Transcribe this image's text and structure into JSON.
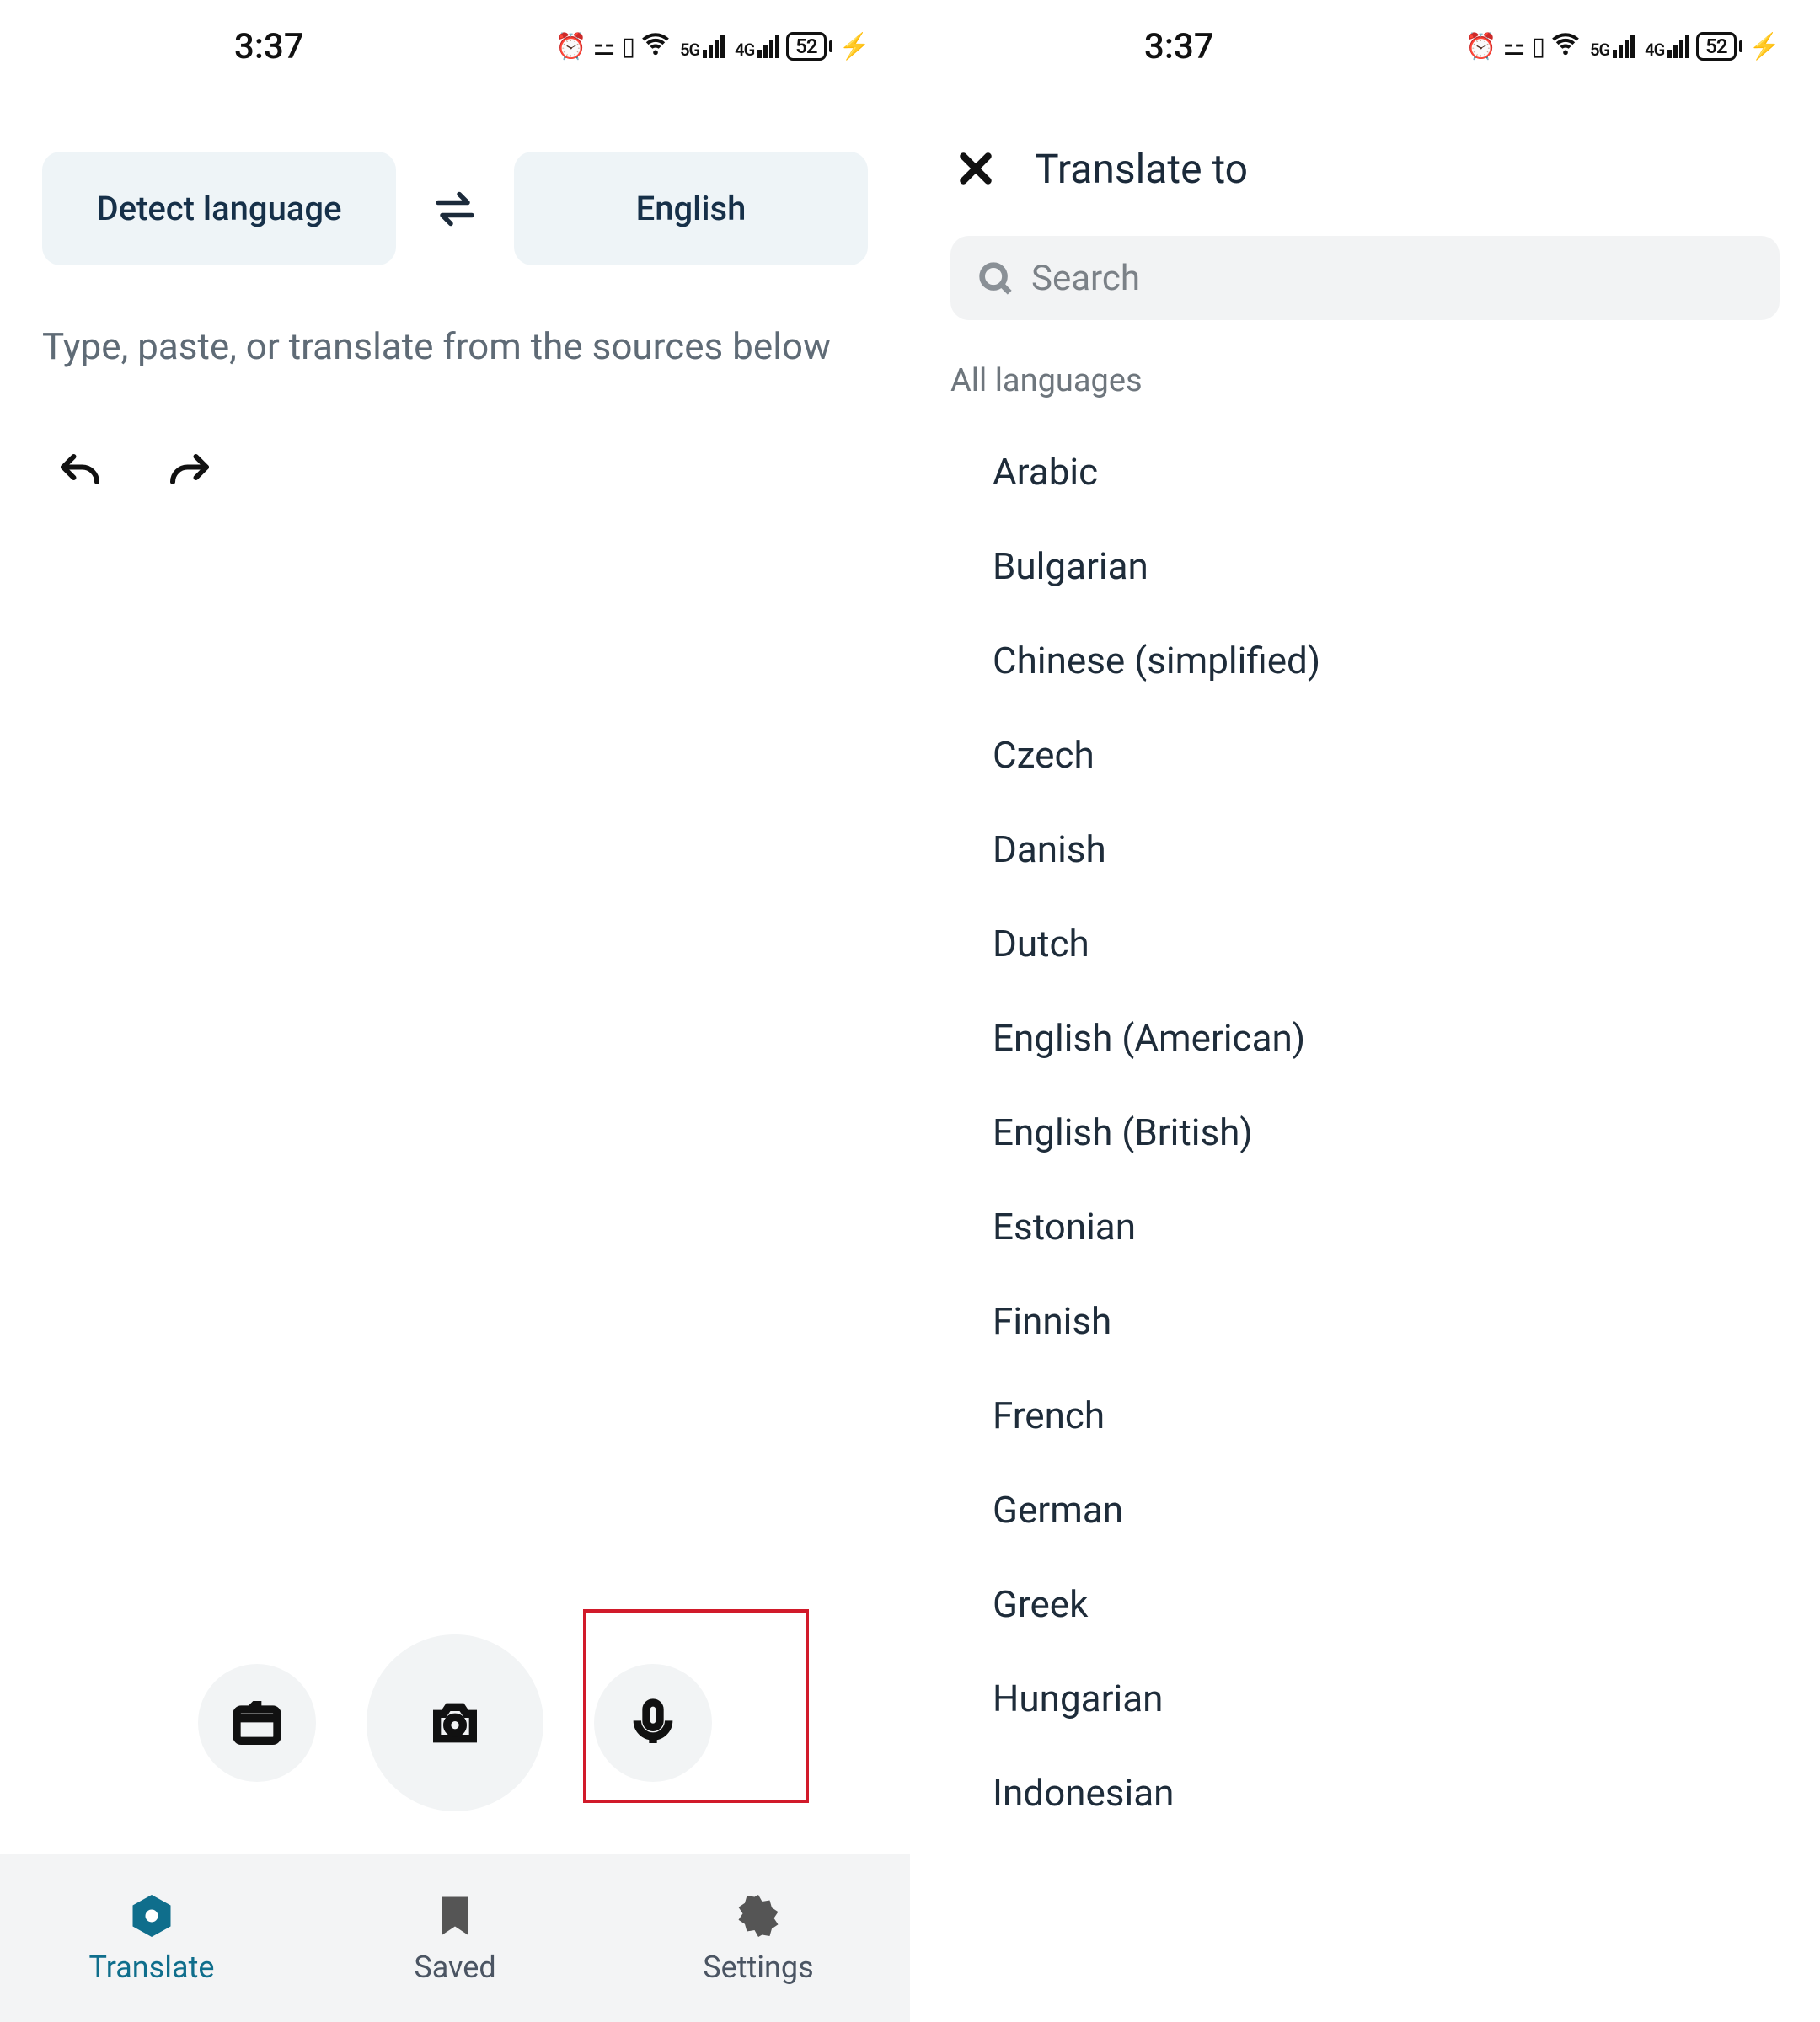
{
  "status": {
    "time": "3:37",
    "battery": "52",
    "net1": "5G",
    "net2": "4G"
  },
  "left": {
    "source_lang": "Detect language",
    "target_lang": "English",
    "input_placeholder": "Type, paste, or translate from the sources below",
    "tabs": {
      "translate": "Translate",
      "saved": "Saved",
      "settings": "Settings"
    }
  },
  "right": {
    "header": "Translate to",
    "search_placeholder": "Search",
    "section": "All languages",
    "languages": [
      "Arabic",
      "Bulgarian",
      "Chinese (simplified)",
      "Czech",
      "Danish",
      "Dutch",
      "English (American)",
      "English (British)",
      "Estonian",
      "Finnish",
      "French",
      "German",
      "Greek",
      "Hungarian",
      "Indonesian"
    ]
  }
}
